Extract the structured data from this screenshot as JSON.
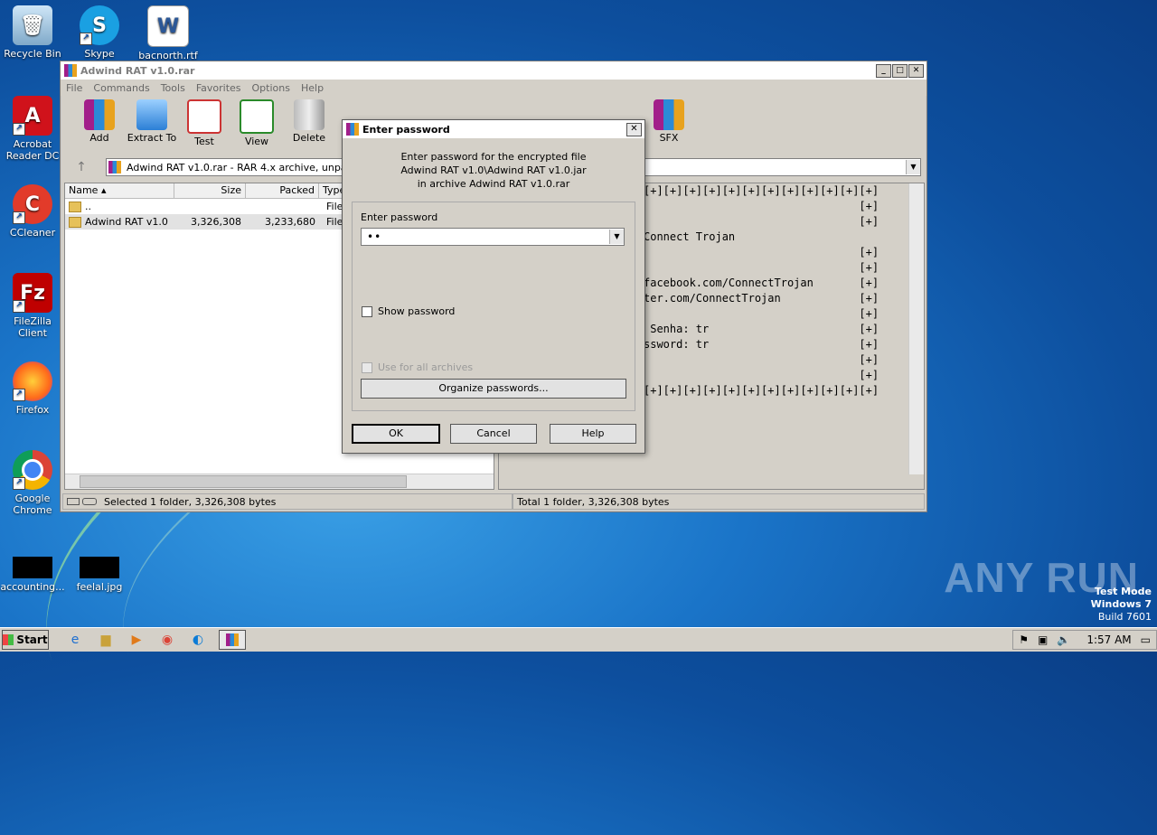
{
  "desktop": {
    "icons": [
      {
        "label": "Recycle Bin"
      },
      {
        "label": "Skype"
      },
      {
        "label": "bacnorth.rtf"
      },
      {
        "label": "Acrobat Reader DC"
      },
      {
        "label": "CCleaner"
      },
      {
        "label": "FileZilla Client"
      },
      {
        "label": "Firefox"
      },
      {
        "label": "Google Chrome"
      },
      {
        "label": "accounting..."
      },
      {
        "label": "feelal.jpg"
      }
    ],
    "watermark": "ANY RUN",
    "test_mode": [
      "Test Mode",
      "Windows 7",
      "Build 7601"
    ]
  },
  "winrar": {
    "title": "Adwind RAT v1.0.rar",
    "menu": [
      "File",
      "Commands",
      "Tools",
      "Favorites",
      "Options",
      "Help"
    ],
    "toolbar": [
      "Add",
      "Extract To",
      "Test",
      "View",
      "Delete",
      "SFX"
    ],
    "address": "Adwind RAT v1.0.rar - RAR 4.x archive, unpack",
    "columns": [
      "Name",
      "Size",
      "Packed",
      "Type"
    ],
    "rows": [
      {
        "name": "..",
        "size": "",
        "packed": "",
        "type": "File f"
      },
      {
        "name": "Adwind RAT v1.0",
        "size": "3,326,308",
        "packed": "3,233,680",
        "type": "File f"
      }
    ],
    "comment_lines": [
      "[+][+][+][+][+][+][+][+][+][+][+][+]",
      "                                 [+]",
      "                                 [+]",
      "Connect Trojan",
      "                                 [+]",
      "                                 [+]",
      "facebook.com/ConnectTrojan       [+]",
      "ter.com/ConnectTrojan            [+]",
      "                                 [+]",
      " Senha: tr                       [+]",
      "ssword: tr                       [+]",
      "                                 [+]",
      "                                 [+]",
      "[+][+][+][+][+][+][+][+][+][+][+][+]"
    ],
    "status_left": "Selected 1 folder, 3,326,308 bytes",
    "status_right": "Total 1 folder, 3,326,308 bytes"
  },
  "dialog": {
    "title": "Enter password",
    "message_line1": "Enter password for the encrypted file",
    "message_line2": "Adwind RAT v1.0\\Adwind RAT v1.0.jar",
    "message_line3": "in archive Adwind RAT v1.0.rar",
    "field_label": "Enter password",
    "password_mask": "••",
    "show_password": "Show password",
    "use_for_all": "Use for all archives",
    "organize": "Organize passwords...",
    "ok": "OK",
    "cancel": "Cancel",
    "help": "Help"
  },
  "taskbar": {
    "start": "Start",
    "clock": "1:57 AM"
  }
}
